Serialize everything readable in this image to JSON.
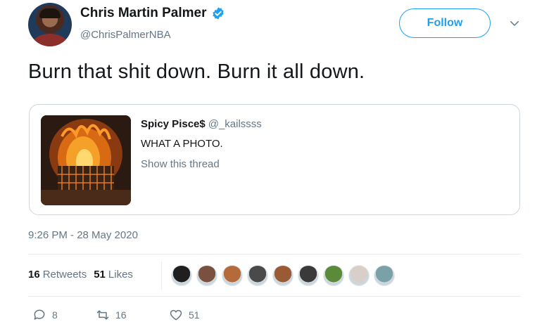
{
  "author": {
    "name": "Chris Martin Palmer",
    "handle": "@ChrisPalmerNBA"
  },
  "follow_label": "Follow",
  "tweet_text": "Burn that shit down. Burn it all down.",
  "quote": {
    "name": "Spicy Pisce$",
    "handle": "@_kailssss",
    "text": "WHAT A PHOTO.",
    "show_thread": "Show this thread"
  },
  "timestamp": "9:26 PM - 28 May 2020",
  "stats": {
    "retweets_count": "16",
    "retweets_label": "Retweets",
    "likes_count": "51",
    "likes_label": "Likes"
  },
  "liker_colors": [
    "#1f1f1f",
    "#7a5040",
    "#b56a3a",
    "#4a4a4a",
    "#9a5a34",
    "#3a3a3a",
    "#5a8a3a",
    "#d8d0c8",
    "#7aa0a8"
  ],
  "actions": {
    "replies": "8",
    "retweets": "16",
    "likes": "51"
  },
  "accent_color": "#1da1f2"
}
